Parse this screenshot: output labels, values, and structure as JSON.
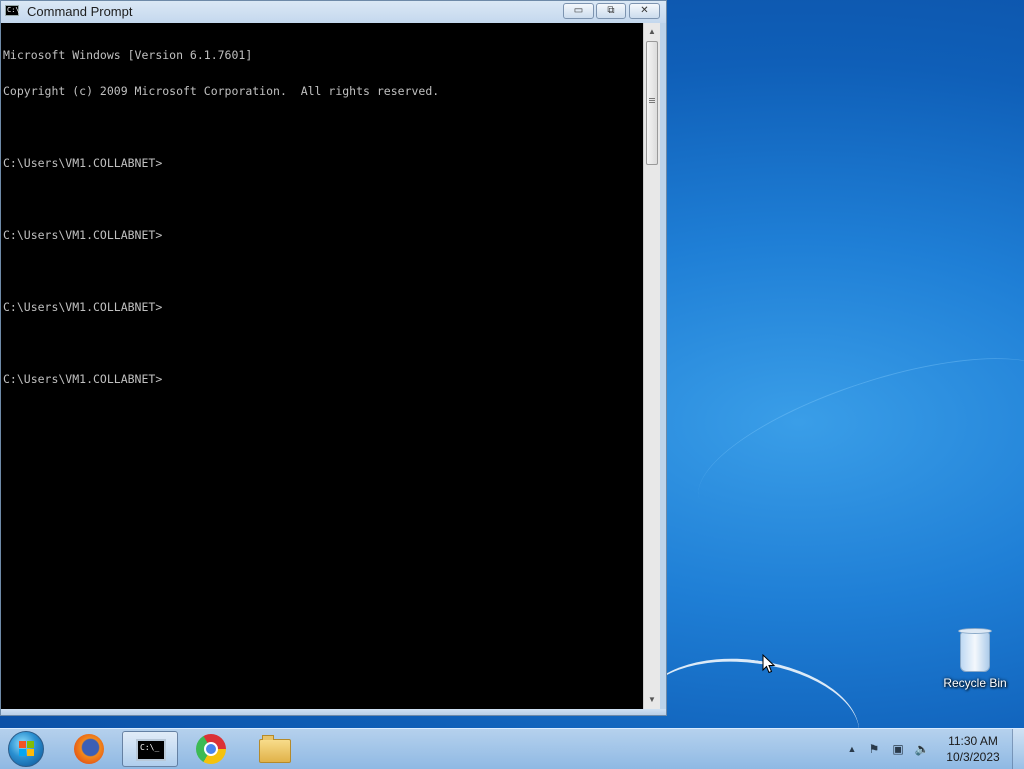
{
  "window": {
    "title": "Command Prompt",
    "icon": "cmd-icon",
    "buttons": {
      "minimize": "▭",
      "maximize": "⧉",
      "close": "✕"
    }
  },
  "console": {
    "lines": [
      "Microsoft Windows [Version 6.1.7601]",
      "Copyright (c) 2009 Microsoft Corporation.  All rights reserved.",
      "",
      "C:\\Users\\VM1.COLLABNET>",
      "",
      "C:\\Users\\VM1.COLLABNET>",
      "",
      "C:\\Users\\VM1.COLLABNET>",
      "",
      "C:\\Users\\VM1.COLLABNET>"
    ]
  },
  "desktop": {
    "icons": [
      {
        "label": "Recycle Bin",
        "icon": "recycle-bin-icon"
      }
    ]
  },
  "taskbar": {
    "items": [
      {
        "name": "firefox",
        "icon": "firefox-icon"
      },
      {
        "name": "command-prompt",
        "icon": "cmd-icon",
        "active": true
      },
      {
        "name": "chrome",
        "icon": "chrome-icon"
      },
      {
        "name": "windows-explorer",
        "icon": "folder-icon"
      }
    ],
    "tray": {
      "overflow": "▲",
      "icons": [
        "action-center-icon",
        "network-icon",
        "volume-muted-icon"
      ]
    },
    "clock": {
      "time": "11:30 AM",
      "date": "10/3/2023"
    }
  },
  "colors": {
    "console_bg": "#000000",
    "console_fg": "#c0c0c0",
    "desktop_blue": "#1f7fd6"
  }
}
